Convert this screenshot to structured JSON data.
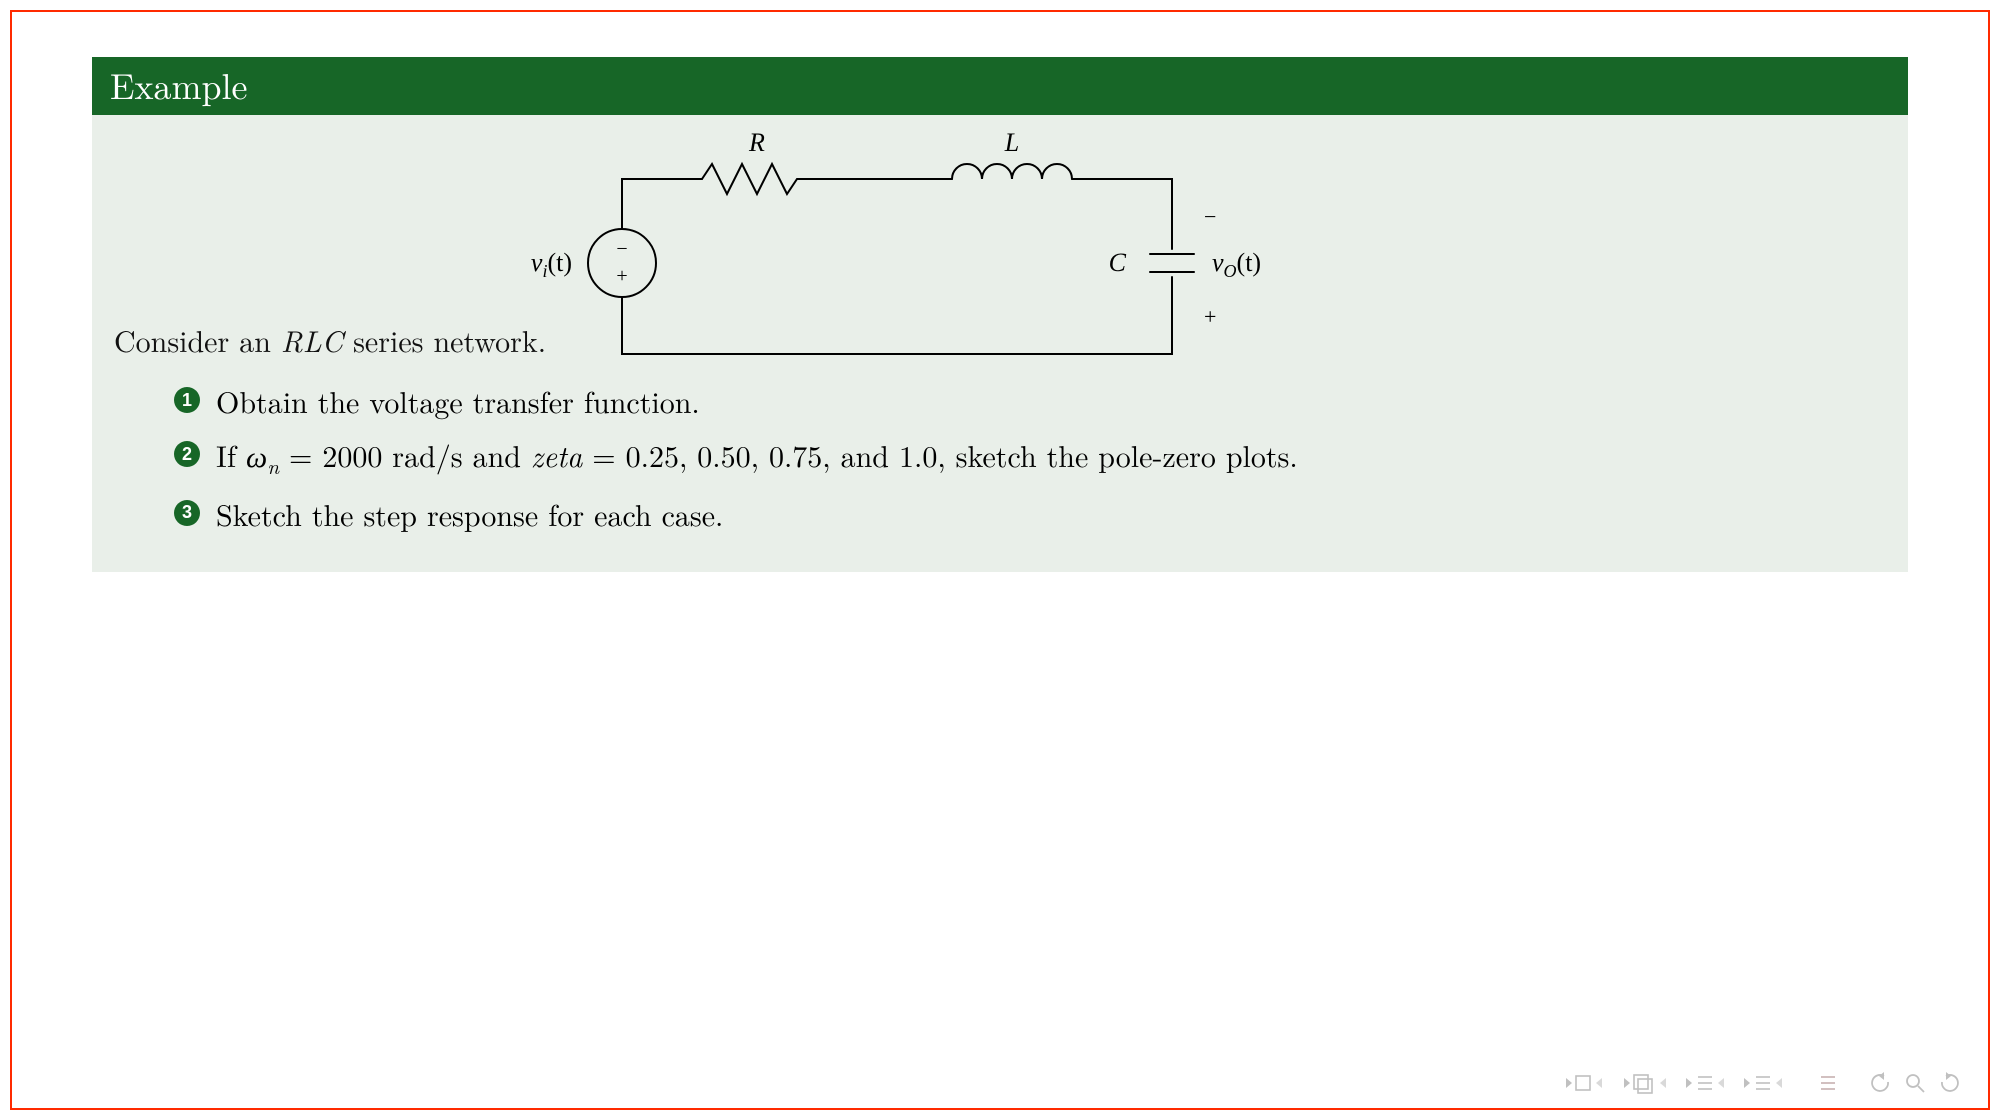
{
  "colors": {
    "accent": "#176627",
    "block_bg": "#e9efe9",
    "border": "#ff2a00",
    "nav_inactive": "#c0c0c0",
    "nav_accent_faint": "#d8c8c8"
  },
  "block": {
    "title": "Example",
    "intro_prefix": "Consider an ",
    "intro_italic": "RLC",
    "intro_suffix": " series network."
  },
  "items": [
    {
      "n": "1",
      "text": "Obtain the voltage transfer function."
    },
    {
      "n": "2",
      "text_before": "If ",
      "omega_sym": "ω",
      "omega_sub": "n",
      "eq1": " = 2000 rad/s",
      "mid": " and ",
      "zeta": "zeta",
      "eq2": " = 0.25, 0.50, 0.75,",
      "tail": " and 1.0, sketch the pole-zero plots."
    },
    {
      "n": "3",
      "text": "Sketch the step response for each case."
    }
  ],
  "circuit": {
    "R_label": "R",
    "L_label": "L",
    "C_label": "C",
    "vin_label_sym": "v",
    "vin_label_sub": "i",
    "vin_label_arg": "(t)",
    "vout_label_sym": "v",
    "vout_label_sub": "O",
    "vout_label_arg": "(t)",
    "source_minus": "−",
    "source_plus": "+",
    "cap_minus": "−",
    "cap_plus": "+"
  },
  "nav": {
    "tooltip_first_slide": "first slide",
    "tooltip_prev_slide": "previous slide",
    "tooltip_prev_section": "previous section",
    "tooltip_next_section": "next section",
    "tooltip_outline": "outline",
    "tooltip_undo": "undo",
    "tooltip_search": "search",
    "tooltip_redo": "redo"
  }
}
